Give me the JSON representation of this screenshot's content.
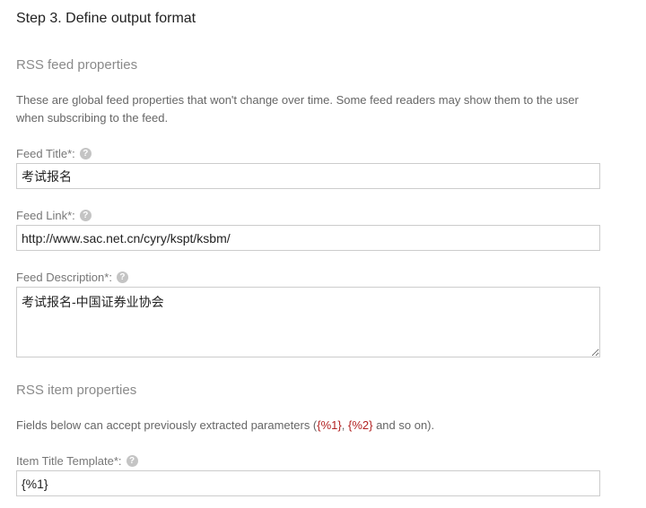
{
  "step_title": "Step 3. Define output format",
  "rss_feed": {
    "section_title": "RSS feed properties",
    "description": "These are global feed properties that won't change over time. Some feed readers may show them to the user when subscribing to the feed.",
    "feed_title": {
      "label": "Feed Title*:",
      "value": "考试报名"
    },
    "feed_link": {
      "label": "Feed Link*:",
      "value": "http://www.sac.net.cn/cyry/kspt/ksbm/"
    },
    "feed_description": {
      "label": "Feed Description*:",
      "value": "考试报名-中国证券业协会"
    }
  },
  "rss_item": {
    "section_title": "RSS item properties",
    "description_before": "Fields below can accept previously extracted parameters (",
    "param1": "{%1}",
    "separator": ", ",
    "param2": "{%2}",
    "description_after": " and so on).",
    "item_title": {
      "label": "Item Title Template*:",
      "value": "{%1}"
    }
  },
  "help_icon_glyph": "?",
  "colors": {
    "highlight": "#b22222",
    "help_icon": "#c4c4c4"
  }
}
